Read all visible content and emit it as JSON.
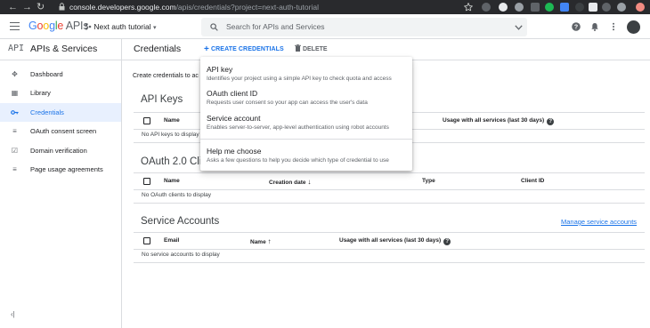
{
  "browser": {
    "url_host": "console.developers.google.com",
    "url_path": "/apis/credentials?project=next-auth-tutorial"
  },
  "header": {
    "logo_google": "Google",
    "logo_apis": "APIs",
    "project_name": "Next auth tutorial",
    "search_placeholder": "Search for APIs and Services"
  },
  "sidebar": {
    "section_icon": "API",
    "section_title": "APIs & Services",
    "items": [
      {
        "label": "Dashboard",
        "icon": "dashboard-icon"
      },
      {
        "label": "Library",
        "icon": "library-icon"
      },
      {
        "label": "Credentials",
        "icon": "key-icon",
        "active": true
      },
      {
        "label": "OAuth consent screen",
        "icon": "consent-icon"
      },
      {
        "label": "Domain verification",
        "icon": "checkbox-icon"
      },
      {
        "label": "Page usage agreements",
        "icon": "settings-icon"
      }
    ]
  },
  "toolbar": {
    "title": "Credentials",
    "create_label": "CREATE CREDENTIALS",
    "delete_label": "DELETE"
  },
  "intro_text": "Create credentials to ac",
  "api_keys": {
    "title": "API Keys",
    "col_name": "Name",
    "col_usage": "Usage with all services (last 30 days)",
    "empty": "No API keys to display"
  },
  "oauth": {
    "title": "OAuth 2.0 Clie",
    "col_name": "Name",
    "col_created": "Creation date",
    "col_type": "Type",
    "col_client_id": "Client ID",
    "empty": "No OAuth clients to display"
  },
  "service_accounts": {
    "title": "Service Accounts",
    "manage_link": "Manage service accounts",
    "col_email": "Email",
    "col_name": "Name",
    "col_usage": "Usage with all services (last 30 days)",
    "empty": "No service accounts to display"
  },
  "dropdown": {
    "items": [
      {
        "title": "API key",
        "desc": "Identifies your project using a simple API key to check quota and access"
      },
      {
        "title": "OAuth client ID",
        "desc": "Requests user consent so your app can access the user's data"
      },
      {
        "title": "Service account",
        "desc": "Enables server-to-server, app-level authentication using robot accounts"
      },
      {
        "title": "Help me choose",
        "desc": "Asks a few questions to help you decide which type of credential to use"
      }
    ]
  },
  "colors": {
    "accent": "#1a73e8",
    "active_bg": "#e8f0fe",
    "chrome_bg": "#292a2d"
  }
}
